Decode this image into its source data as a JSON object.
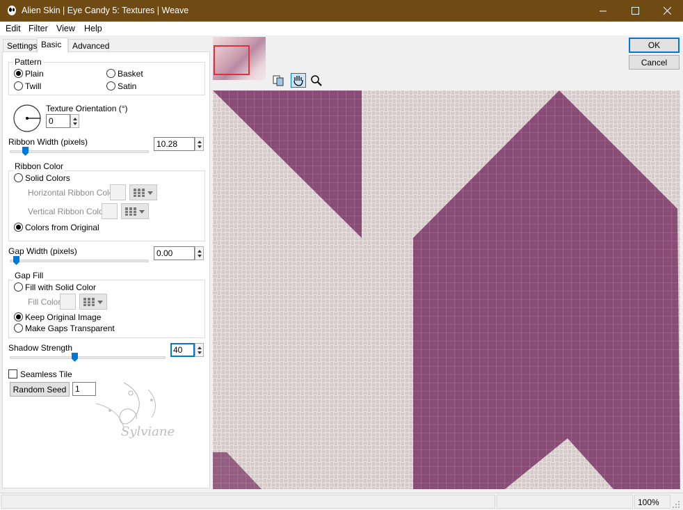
{
  "window": {
    "title": "Alien Skin | Eye Candy 5: Textures | Weave",
    "titlebar_color": "#6f4a12"
  },
  "menu": {
    "items": [
      "Edit",
      "Filter",
      "View",
      "Help"
    ]
  },
  "tabs": [
    "Settings",
    "Basic",
    "Advanced"
  ],
  "active_tab": "Basic",
  "pattern": {
    "label": "Pattern",
    "options": [
      "Plain",
      "Twill",
      "Basket",
      "Satin"
    ],
    "selected": "Plain"
  },
  "texture_orientation": {
    "label": "Texture Orientation (°)",
    "value": "0"
  },
  "ribbon_width": {
    "label": "Ribbon Width (pixels)",
    "value": "10.28"
  },
  "ribbon_color": {
    "label": "Ribbon Color",
    "solid_colors_label": "Solid Colors",
    "horizontal_label": "Horizontal Ribbon Color",
    "vertical_label": "Vertical Ribbon Color",
    "from_original_label": "Colors from Original",
    "selected": "Colors from Original"
  },
  "gap_width": {
    "label": "Gap Width (pixels)",
    "value": "0.00"
  },
  "gap_fill": {
    "label": "Gap Fill",
    "fill_solid_label": "Fill with Solid Color",
    "fill_color_label": "Fill Color",
    "keep_original_label": "Keep Original Image",
    "transparent_label": "Make Gaps Transparent",
    "selected": "Keep Original Image"
  },
  "shadow_strength": {
    "label": "Shadow Strength",
    "value": "40"
  },
  "seamless_tile": {
    "label": "Seamless Tile",
    "checked": false
  },
  "random_seed": {
    "button_label": "Random Seed",
    "value": "1"
  },
  "buttons": {
    "ok": "OK",
    "cancel": "Cancel"
  },
  "watermark_text": "Sylviane",
  "status": {
    "zoom": "100%"
  },
  "colors": {
    "accent": "#0078d7",
    "purple": "#8e4f7c",
    "linen": "#e9e1e0"
  }
}
